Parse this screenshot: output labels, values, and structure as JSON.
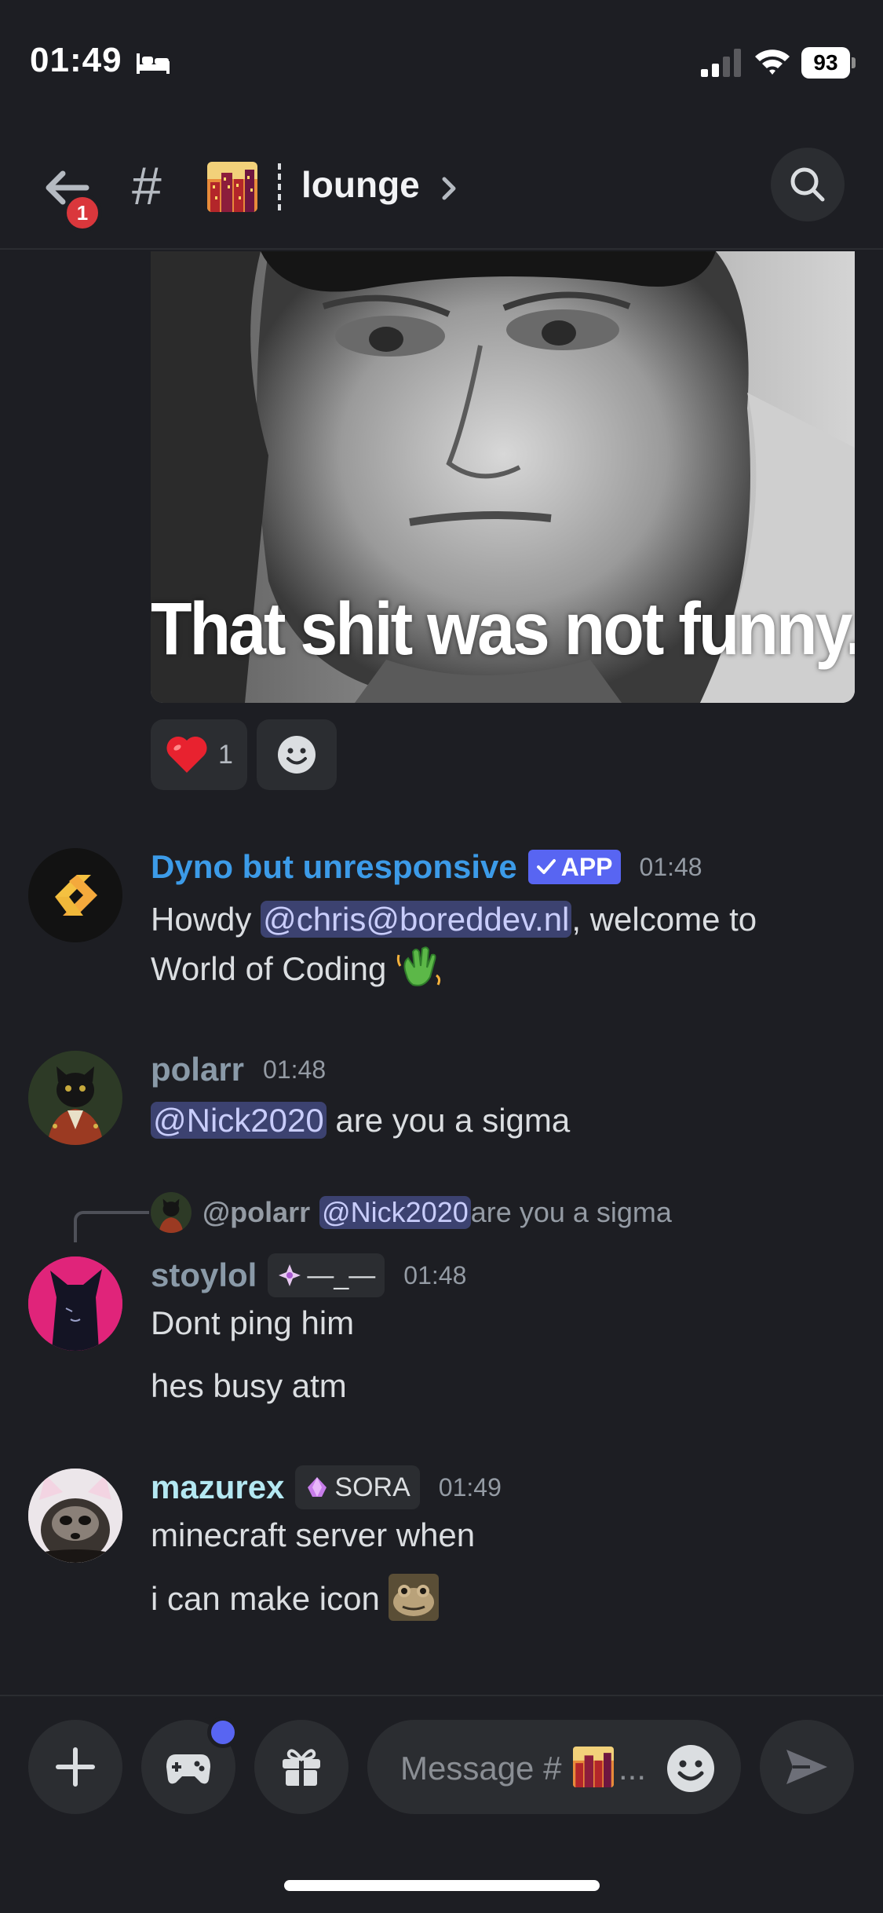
{
  "status_bar": {
    "time": "01:49",
    "battery": "93"
  },
  "header": {
    "channel": "lounge",
    "back_badge": "1",
    "hash": "#"
  },
  "attachment": {
    "caption": "That shit was not funny.."
  },
  "reactions": [
    {
      "emoji": "❤️",
      "count": "1"
    }
  ],
  "messages": [
    {
      "username": "Dyno but unresponsive",
      "username_color": "#3c9be8",
      "tag": "APP",
      "time": "01:48",
      "line1_before": "Howdy ",
      "line1_mention": "@chris@boreddev.nl",
      "line1_after": ", welcome to",
      "line2": "World of Coding",
      "line2_emoji": "👋"
    },
    {
      "username": "polarr",
      "username_color": "#8a9aa8",
      "time": "01:48",
      "mention": "@Nick2020",
      "text": " are you a sigma"
    },
    {
      "reply": {
        "user": "@polarr",
        "mention": "@Nick2020",
        "text": " are you a sigma"
      },
      "username": "stoylol",
      "username_color": "#8a9aa8",
      "tag": "—_—",
      "time": "01:48",
      "lines": [
        "Dont ping him",
        "hes busy atm"
      ]
    },
    {
      "username": "mazurex",
      "username_color": "#b4e8f2",
      "tag": "SORA",
      "time": "01:49",
      "lines": [
        "minecraft server when",
        "i can make icon"
      ]
    }
  ],
  "composer": {
    "placeholder": "Message #",
    "ellipsis": "..."
  }
}
